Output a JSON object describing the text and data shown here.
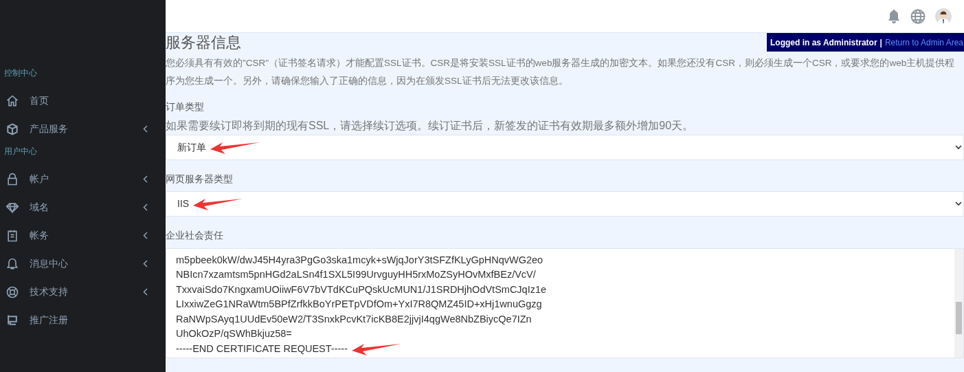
{
  "sidebar": {
    "sections": [
      {
        "title": "控制中心",
        "items": [
          {
            "label": "首页",
            "has_submenu": false
          },
          {
            "label": "产品服务",
            "has_submenu": true
          }
        ]
      },
      {
        "title": "用户中心",
        "items": [
          {
            "label": "帐户",
            "has_submenu": true
          },
          {
            "label": "域名",
            "has_submenu": true
          },
          {
            "label": "帐务",
            "has_submenu": true
          },
          {
            "label": "消息中心",
            "has_submenu": true
          },
          {
            "label": "技术支持",
            "has_submenu": true
          },
          {
            "label": "推广注册",
            "has_submenu": false
          }
        ]
      }
    ]
  },
  "admin_bar": {
    "text": "Logged in as Administrator",
    "separator": "|",
    "link": "Return to Admin Area"
  },
  "page": {
    "title": "服务器信息",
    "description_lines": [
      "您必须具有有效的\"CSR\"（证书签名请求）才能配置SSL证书。CSR是将安装SSL证书的web服务器生成的加密文本。如果您还没有CSR，则必须生成一个CSR，或要求您的web主机提供程",
      "序为您生成一个。另外，请确保您输入了正确的信息，因为在颁发SSL证书后无法更改该信息。"
    ],
    "fields": [
      {
        "kind": "select",
        "label": "订单类型",
        "help": "如果需要续订即将到期的现有SSL，请选择续订选项。续订证书后，新签发的证书有效期最多额外增加90天。",
        "value": "新订单",
        "marked": true
      },
      {
        "kind": "select",
        "label": "网页服务器类型",
        "value": "IIS",
        "marked": true
      },
      {
        "kind": "textarea",
        "label": "企业社会责任",
        "lines": [
          "m5pbeek0kW/dwJ45H4yra3PgGo3ska1mcyk+sWjqJorY3tSFZfKLyGpHNqvWG2eo",
          "NBIcn7xzamtsm5pnHGd2aLSn4f1SXL5I99UrvguyHH5rxMoZSyHOvMxfBEz/VcV/",
          "TxxvaiSdo7KngxamUOiiwF6V7bVTdKCuPQskUcMUN1/J1SRDHjhOdVtSmCJqIz1e",
          "LIxxiwZeG1NRaWtm5BPfZrfkkBoYrPETpVDfOm+YxI7R8QMZ45ID+xHj1wnuGgzg",
          "RaNWpSAyq1UUdEv50eW2/T3SnxkPcvKt7icKB8E2jjvjI4qgWe8NbZBiycQe7IZn",
          "UhOkOzP/qSWhBkjuz58=",
          "-----END CERTIFICATE REQUEST-----"
        ],
        "marked": true
      }
    ]
  }
}
